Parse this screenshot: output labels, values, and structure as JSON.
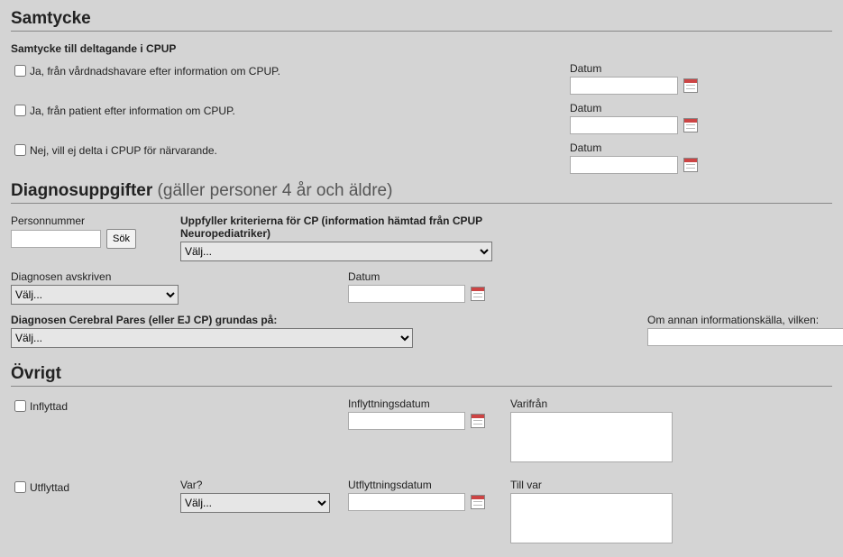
{
  "samtycke": {
    "title": "Samtycke",
    "subheading": "Samtycke till deltagande i CPUP",
    "rows": [
      {
        "label": "Ja, från vårdnadshavare efter information om CPUP.",
        "datum_label": "Datum",
        "datum_value": ""
      },
      {
        "label": "Ja, från patient efter information om CPUP.",
        "datum_label": "Datum",
        "datum_value": ""
      },
      {
        "label": "Nej, vill ej delta i CPUP för närvarande.",
        "datum_label": "Datum",
        "datum_value": ""
      }
    ]
  },
  "diagnos": {
    "title": "Diagnosuppgifter",
    "title_suffix": " (gäller personer 4 år och äldre)",
    "personnummer_label": "Personnummer",
    "personnummer_value": "",
    "sok_label": "Sök",
    "kriterier_label": "Uppfyller kriterierna för CP (information hämtad från CPUP Neuropediatriker)",
    "kriterier_value": "Välj...",
    "avskriven_label": "Diagnosen avskriven",
    "avskriven_value": "Välj...",
    "datum_label": "Datum",
    "datum_value": "",
    "grund_label": "Diagnosen Cerebral Pares (eller EJ CP) grundas på:",
    "grund_value": "Välj...",
    "annan_label": "Om annan informationskälla, vilken:",
    "annan_value": ""
  },
  "ovrigt": {
    "title": "Övrigt",
    "inflyttad": {
      "checkbox_label": "Inflyttad",
      "datum_label": "Inflyttningsdatum",
      "datum_value": "",
      "varifran_label": "Varifrån",
      "varifran_value": ""
    },
    "utflyttad": {
      "checkbox_label": "Utflyttad",
      "var_label": "Var?",
      "var_value": "Välj...",
      "datum_label": "Utflyttningsdatum",
      "datum_value": "",
      "tillvar_label": "Till var",
      "tillvar_value": ""
    }
  }
}
